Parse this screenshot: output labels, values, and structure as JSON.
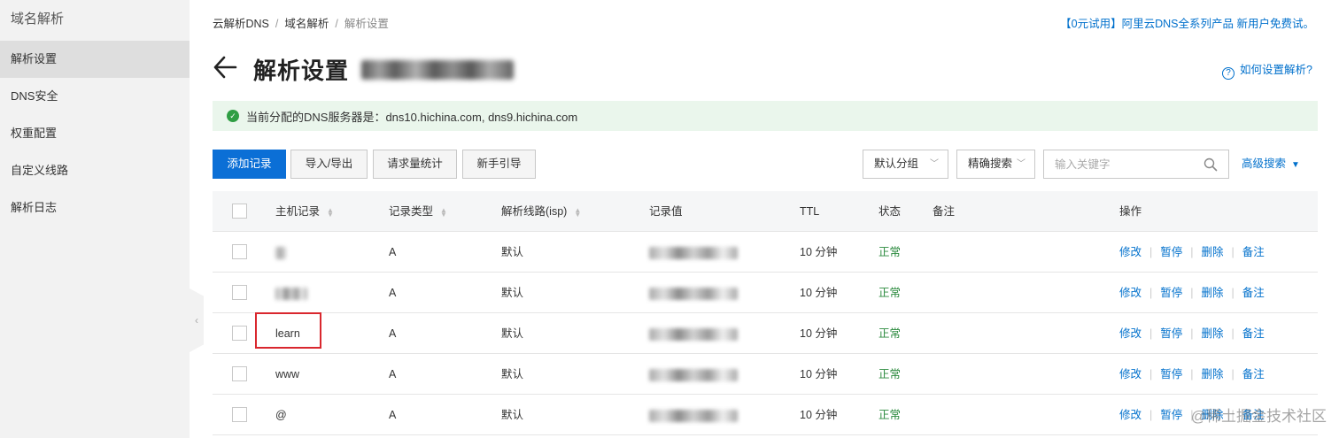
{
  "sidebar": {
    "title": "域名解析",
    "items": [
      {
        "label": "解析设置",
        "active": true
      },
      {
        "label": "DNS安全",
        "active": false
      },
      {
        "label": "权重配置",
        "active": false
      },
      {
        "label": "自定义线路",
        "active": false
      },
      {
        "label": "解析日志",
        "active": false
      }
    ],
    "collapse_glyph": "‹"
  },
  "breadcrumb": {
    "items": [
      "云解析DNS",
      "域名解析",
      "解析设置"
    ],
    "separator": "/"
  },
  "promo_link": "【0元试用】阿里云DNS全系列产品 新用户免费试。",
  "header": {
    "title": "解析设置",
    "help_link": "如何设置解析?",
    "help_icon": "?"
  },
  "notice": {
    "icon": "check-circle-icon",
    "text": "当前分配的DNS服务器是：dns10.hichina.com, dns9.hichina.com"
  },
  "toolbar": {
    "add_record": "添加记录",
    "import_export": "导入/导出",
    "request_stats": "请求量统计",
    "beginner_guide": "新手引导",
    "group_select": "默认分组",
    "exact_search_select": "精确搜索",
    "search_placeholder": "输入关键字",
    "advanced_search": "高级搜索"
  },
  "table": {
    "columns": {
      "host": "主机记录",
      "type": "记录类型",
      "line": "解析线路(isp)",
      "value": "记录值",
      "ttl": "TTL",
      "status": "状态",
      "remark": "备注",
      "actions": "操作"
    },
    "rows": [
      {
        "host": "",
        "type": "A",
        "line": "默认",
        "ttl": "10 分钟",
        "status": "正常"
      },
      {
        "host": "",
        "type": "A",
        "line": "默认",
        "ttl": "10 分钟",
        "status": "正常"
      },
      {
        "host": "learn",
        "type": "A",
        "line": "默认",
        "ttl": "10 分钟",
        "status": "正常"
      },
      {
        "host": "www",
        "type": "A",
        "line": "默认",
        "ttl": "10 分钟",
        "status": "正常"
      },
      {
        "host": "@",
        "type": "A",
        "line": "默认",
        "ttl": "10 分钟",
        "status": "正常"
      }
    ],
    "row_actions": [
      "修改",
      "暂停",
      "删除",
      "备注"
    ]
  },
  "watermark": "@稀土掘金技术社区",
  "colors": {
    "primary": "#0b6fd6",
    "link": "#0070cc",
    "status_ok": "#2b8a3e",
    "highlight": "#d9272e",
    "notice_bg": "#eaf6ec"
  }
}
